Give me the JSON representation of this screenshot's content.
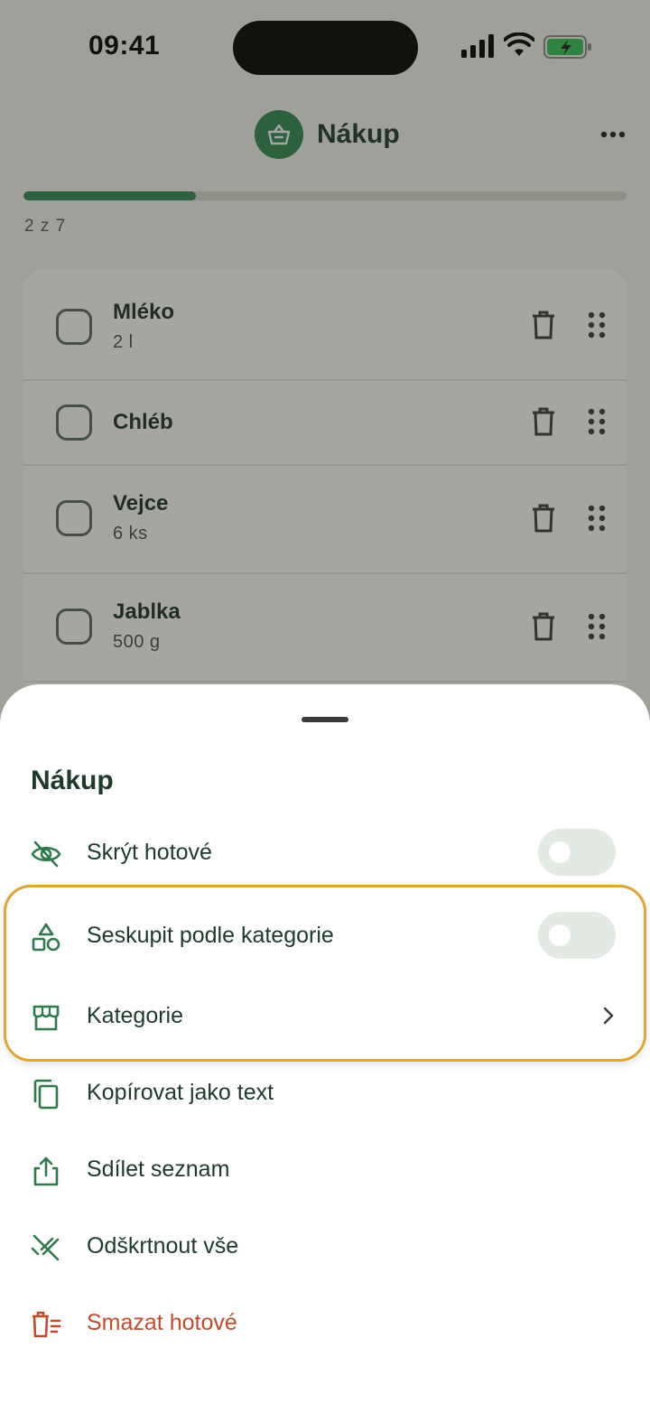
{
  "status": {
    "time": "09:41"
  },
  "header": {
    "title": "Nákup",
    "icon": "basket-icon",
    "more_icon": "ellipsis-icon"
  },
  "progress": {
    "done": 2,
    "total": 7,
    "fraction": 0.2857,
    "text": "2 z 7"
  },
  "items": [
    {
      "name": "Mléko",
      "qty": "2 l"
    },
    {
      "name": "Chléb",
      "qty": ""
    },
    {
      "name": "Vejce",
      "qty": "6 ks"
    },
    {
      "name": "Jablka",
      "qty": "500 g"
    }
  ],
  "sheet": {
    "title": "Nákup",
    "options": [
      {
        "label": "Skrýt hotové",
        "icon": "eye-off-icon",
        "control": "toggle",
        "on": false
      },
      {
        "label": "Seskupit podle kategorie",
        "icon": "shapes-icon",
        "control": "toggle",
        "on": false
      },
      {
        "label": "Kategorie",
        "icon": "store-icon",
        "control": "chevron"
      },
      {
        "label": "Kopírovat jako text",
        "icon": "copy-icon",
        "control": "none"
      },
      {
        "label": "Sdílet seznam",
        "icon": "share-icon",
        "control": "none"
      },
      {
        "label": "Odškrtnout vše",
        "icon": "uncheck-all-icon",
        "control": "none"
      },
      {
        "label": "Smazat hotové",
        "icon": "delete-done-icon",
        "control": "none",
        "danger": true
      }
    ]
  },
  "colors": {
    "accent": "#2e8a52",
    "danger": "#c44a2c",
    "highlight": "#e0a436"
  }
}
